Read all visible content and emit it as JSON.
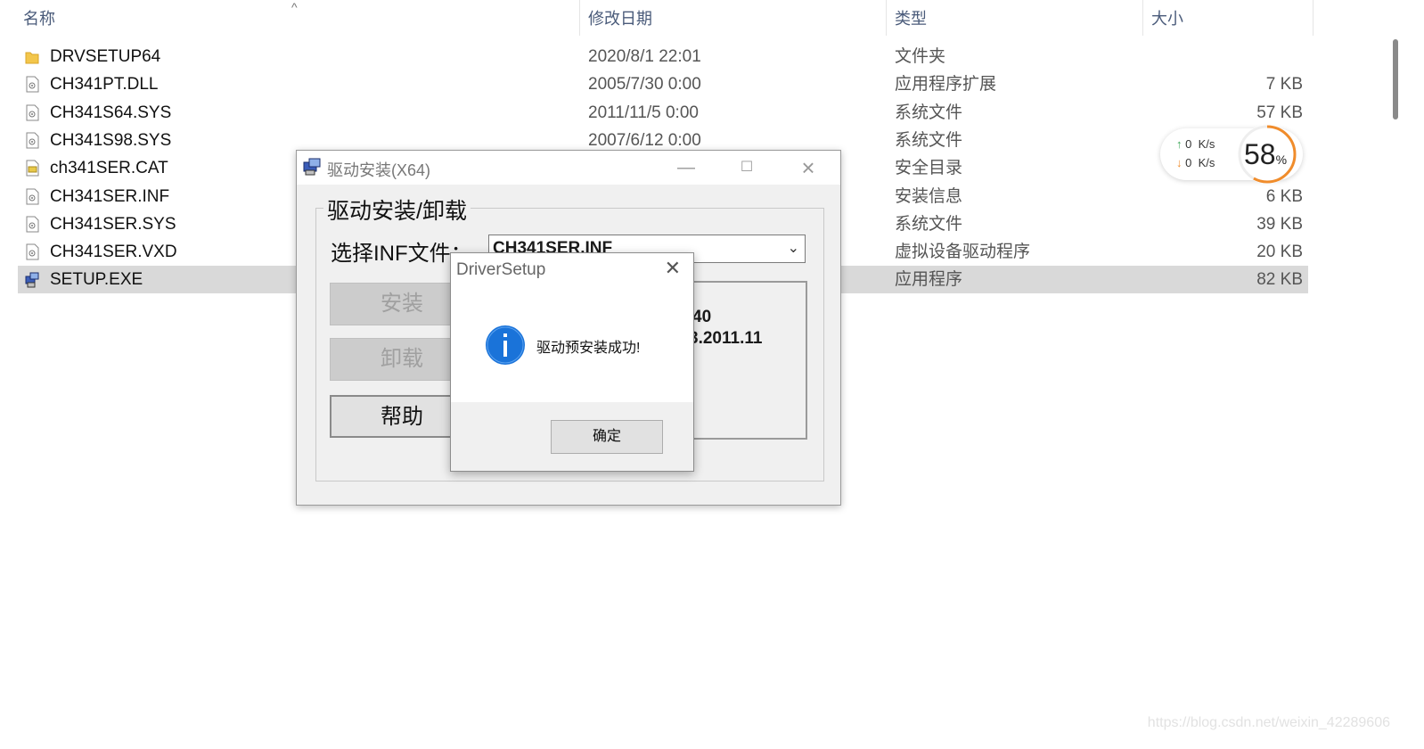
{
  "columns": {
    "name": "名称",
    "date": "修改日期",
    "type": "类型",
    "size": "大小"
  },
  "files": [
    {
      "name": "DRVSETUP64",
      "date": "2020/8/1 22:01",
      "type": "文件夹",
      "size": "",
      "icon": "folder-icon"
    },
    {
      "name": "CH341PT.DLL",
      "date": "2005/7/30 0:00",
      "type": "应用程序扩展",
      "size": "7 KB",
      "icon": "dll-file-icon"
    },
    {
      "name": "CH341S64.SYS",
      "date": "2011/11/5 0:00",
      "type": "系统文件",
      "size": "57 KB",
      "icon": "sys-file-icon"
    },
    {
      "name": "CH341S98.SYS",
      "date": "2007/6/12 0:00",
      "type": "系统文件",
      "size": "",
      "icon": "sys-file-icon"
    },
    {
      "name": "ch341SER.CAT",
      "date": "",
      "type": "安全目录",
      "size": "",
      "icon": "catalog-file-icon"
    },
    {
      "name": "CH341SER.INF",
      "date": "",
      "type": "安装信息",
      "size": "6 KB",
      "icon": "inf-file-icon"
    },
    {
      "name": "CH341SER.SYS",
      "date": "",
      "type": "系统文件",
      "size": "39 KB",
      "icon": "sys-file-icon"
    },
    {
      "name": "CH341SER.VXD",
      "date": "",
      "type": "虚拟设备驱动程序",
      "size": "20 KB",
      "icon": "vxd-file-icon"
    },
    {
      "name": "SETUP.EXE",
      "date": "",
      "type": "应用程序",
      "size": "82 KB",
      "icon": "setup-exe-icon",
      "selected": true
    }
  ],
  "net_widget": {
    "up_value": "0",
    "down_value": "0",
    "unit": "K/s",
    "percent": "58",
    "percent_sign": "%",
    "percent_value": 58
  },
  "driver_dialog": {
    "title": "驱动安装(X64)",
    "group_label": "驱动安装/卸载",
    "inf_label": "选择INF文件：",
    "inf_value": "CH341SER.INF",
    "install_label": "安装",
    "uninstall_label": "卸载",
    "help_label": "帮助",
    "info_line1": "40",
    "info_line2": "3.2011.11"
  },
  "message_box": {
    "title": "DriverSetup",
    "message": "驱动预安装成功!",
    "ok_label": "确定"
  },
  "watermark": "https://blog.csdn.net/weixin_42289606",
  "colors": {
    "selected_row": "#d9d9d9",
    "info_icon": "#1a73d9",
    "gauge": "#f08c2b"
  }
}
